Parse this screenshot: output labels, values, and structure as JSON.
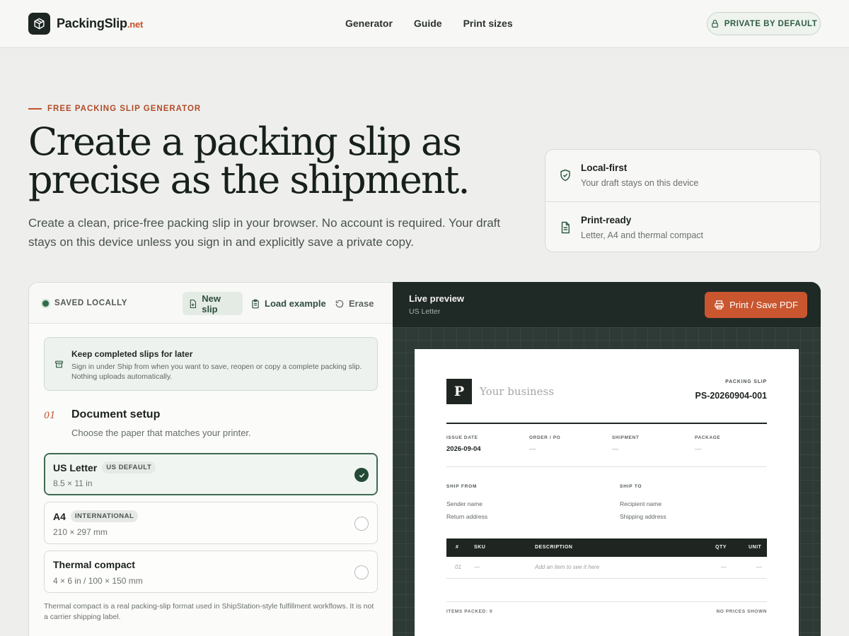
{
  "header": {
    "brand": "PackingSlip",
    "brand_tld": ".net",
    "nav": [
      "Generator",
      "Guide",
      "Print sizes"
    ],
    "private_pill": "PRIVATE BY DEFAULT"
  },
  "hero": {
    "eyebrow": "FREE PACKING SLIP GENERATOR",
    "title_line1": "Create a packing slip as",
    "title_line2": "precise as the shipment.",
    "description": "Create a clean, price-free packing slip in your browser. No account is required. Your draft stays on this device unless you sign in and explicitly save a private copy.",
    "features": [
      {
        "title": "Local-first",
        "subtitle": "Your draft stays on this device",
        "icon": "shield-check-icon"
      },
      {
        "title": "Print-ready",
        "subtitle": "Letter, A4 and thermal compact",
        "icon": "document-icon"
      }
    ]
  },
  "editor": {
    "status": "SAVED LOCALLY",
    "buttons": {
      "new": "New slip",
      "load": "Load example",
      "erase": "Erase"
    },
    "notice": {
      "title": "Keep completed slips for later",
      "body": "Sign in under Ship from when you want to save, reopen or copy a complete packing slip. Nothing uploads automatically."
    },
    "step": {
      "number": "01",
      "title": "Document setup",
      "subtitle": "Choose the paper that matches your printer."
    },
    "paper_options": [
      {
        "name": "US Letter",
        "badge": "US DEFAULT",
        "dims": "8.5 × 11 in",
        "selected": true
      },
      {
        "name": "A4",
        "badge": "INTERNATIONAL",
        "dims": "210 × 297 mm",
        "selected": false
      },
      {
        "name": "Thermal compact",
        "badge": "",
        "dims": "4 × 6 in / 100 × 150 mm",
        "selected": false
      }
    ],
    "note": "Thermal compact is a real packing-slip format used in ShipStation-style fulfillment workflows. It is not a carrier shipping label."
  },
  "preview": {
    "title": "Live preview",
    "subtitle": "US Letter",
    "print_button": "Print / Save PDF",
    "slip": {
      "logo_letter": "P",
      "business": "Your business",
      "label": "PACKING SLIP",
      "number": "PS-20260904-001",
      "meta": [
        {
          "key": "ISSUE DATE",
          "value": "2026-09-04"
        },
        {
          "key": "ORDER / PO",
          "value": "—"
        },
        {
          "key": "SHIPMENT",
          "value": "—"
        },
        {
          "key": "PACKAGE",
          "value": "—"
        }
      ],
      "ship_from": {
        "label": "SHIP FROM",
        "line1": "Sender name",
        "line2": "Return address"
      },
      "ship_to": {
        "label": "SHIP TO",
        "line1": "Recipient name",
        "line2": "Shipping address"
      },
      "columns": [
        "#",
        "SKU",
        "DESCRIPTION",
        "QTY",
        "UNIT"
      ],
      "row": {
        "num": "01",
        "sku": "—",
        "desc": "Add an item to see it here",
        "qty": "—",
        "unit": "—"
      },
      "items_packed": "ITEMS PACKED: 0",
      "no_prices": "NO PRICES SHOWN"
    }
  },
  "colors": {
    "accent": "#c9562f",
    "brand_dark": "#1f2622",
    "green": "#2f6a4a"
  }
}
